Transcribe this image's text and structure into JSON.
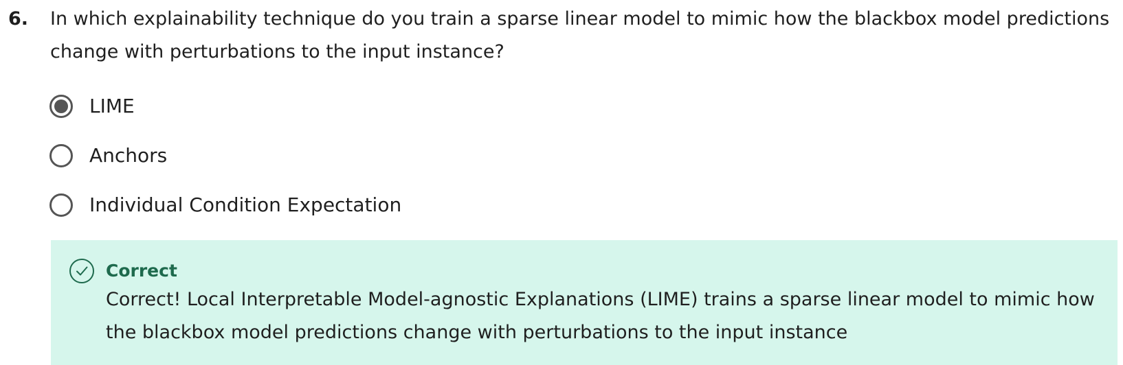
{
  "question": {
    "number": "6.",
    "text": "In which explainability technique do you train a sparse linear model to mimic how the blackbox model predictions change with perturbations to the input instance?"
  },
  "options": [
    {
      "label": "LIME",
      "selected": true
    },
    {
      "label": "Anchors",
      "selected": false
    },
    {
      "label": "Individual Condition Expectation",
      "selected": false
    }
  ],
  "feedback": {
    "icon": "check-circle-icon",
    "title": "Correct",
    "body": "Correct! Local Interpretable Model-agnostic Explanations (LIME) trains a sparse linear model to mimic how the blackbox model predictions change with perturbations to the input instance",
    "colors": {
      "background": "#d6f6ec",
      "accent": "#1e6a4d"
    }
  }
}
